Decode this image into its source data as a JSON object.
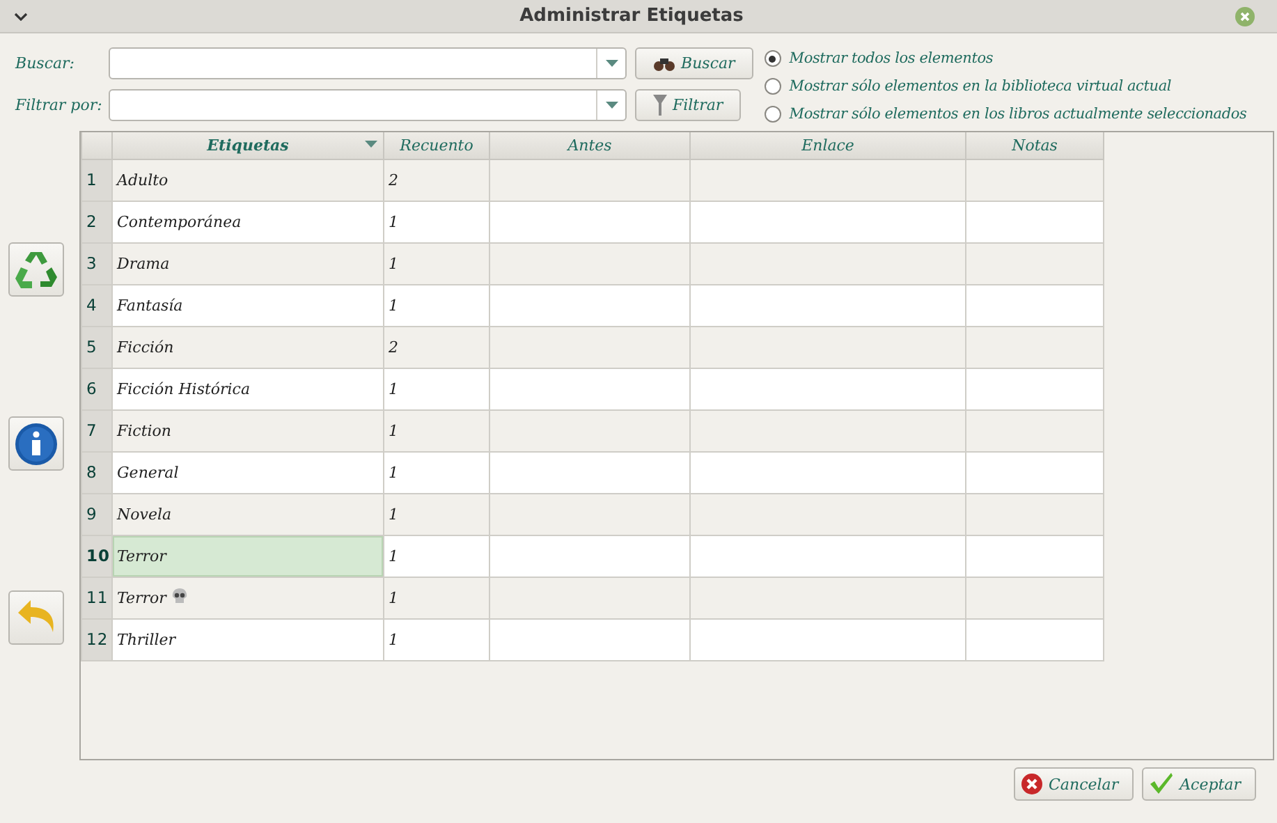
{
  "window": {
    "title": "Administrar Etiquetas"
  },
  "search": {
    "label": "Buscar:",
    "button": "Buscar"
  },
  "filter": {
    "label": "Filtrar por:",
    "button": "Filtrar"
  },
  "scope_options": [
    {
      "label": "Mostrar todos los elementos",
      "selected": true
    },
    {
      "label": "Mostrar sólo elementos en la biblioteca virtual actual",
      "selected": false
    },
    {
      "label": "Mostrar sólo elementos en los libros actualmente seleccionados",
      "selected": false
    }
  ],
  "side_buttons": [
    {
      "kind": "recycle"
    },
    {
      "kind": "info"
    },
    {
      "kind": "undo"
    }
  ],
  "table": {
    "columns": [
      {
        "label": "Etiquetas",
        "sorted": true
      },
      {
        "label": "Recuento",
        "sorted": false
      },
      {
        "label": "Antes",
        "sorted": false
      },
      {
        "label": "Enlace",
        "sorted": false
      },
      {
        "label": "Notas",
        "sorted": false
      }
    ],
    "rows": [
      {
        "number": "1",
        "name": "Adulto",
        "count": "2",
        "selected": false,
        "skull": false
      },
      {
        "number": "2",
        "name": "Contemporánea",
        "count": "1",
        "selected": false,
        "skull": false
      },
      {
        "number": "3",
        "name": "Drama",
        "count": "1",
        "selected": false,
        "skull": false
      },
      {
        "number": "4",
        "name": "Fantasía",
        "count": "1",
        "selected": false,
        "skull": false
      },
      {
        "number": "5",
        "name": "Ficción",
        "count": "2",
        "selected": false,
        "skull": false
      },
      {
        "number": "6",
        "name": "Ficción Histórica",
        "count": "1",
        "selected": false,
        "skull": false
      },
      {
        "number": "7",
        "name": "Fiction",
        "count": "1",
        "selected": false,
        "skull": false
      },
      {
        "number": "8",
        "name": "General",
        "count": "1",
        "selected": false,
        "skull": false
      },
      {
        "number": "9",
        "name": "Novela",
        "count": "1",
        "selected": false,
        "skull": false
      },
      {
        "number": "10",
        "name": "Terror",
        "count": "1",
        "selected": true,
        "skull": false
      },
      {
        "number": "11",
        "name": "Terror",
        "count": "1",
        "selected": false,
        "skull": true
      },
      {
        "number": "12",
        "name": "Thriller",
        "count": "1",
        "selected": false,
        "skull": false
      }
    ]
  },
  "buttons": [
    {
      "kind": "cancel",
      "label": "Cancelar"
    },
    {
      "kind": "ok",
      "label": "Aceptar"
    }
  ]
}
